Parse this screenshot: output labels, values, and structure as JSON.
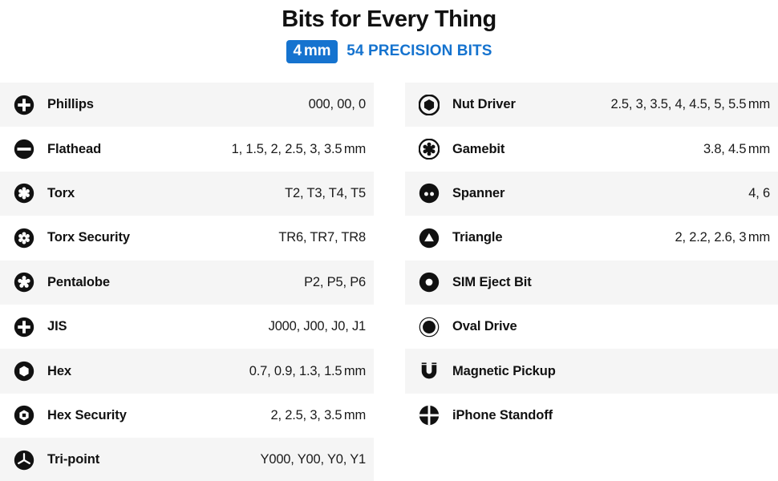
{
  "header": {
    "title": "Bits for Every Thing",
    "badge_value": "4",
    "badge_unit": "mm",
    "count_label": "54 PRECISION BITS",
    "accent_color": "#1573cf"
  },
  "columns": {
    "left": [
      {
        "icon": "phillips-bit-icon",
        "label": "Phillips",
        "value": "000, 00, 0",
        "unit": ""
      },
      {
        "icon": "flathead-bit-icon",
        "label": "Flathead",
        "value": "1, 1.5, 2, 2.5, 3, 3.5",
        "unit": "mm"
      },
      {
        "icon": "torx-bit-icon",
        "label": "Torx",
        "value": "T2, T3, T4, T5",
        "unit": ""
      },
      {
        "icon": "torx-security-bit-icon",
        "label": "Torx Security",
        "value": "TR6, TR7, TR8",
        "unit": ""
      },
      {
        "icon": "pentalobe-bit-icon",
        "label": "Pentalobe",
        "value": "P2, P5, P6",
        "unit": ""
      },
      {
        "icon": "jis-bit-icon",
        "label": "JIS",
        "value": "J000, J00, J0, J1",
        "unit": ""
      },
      {
        "icon": "hex-bit-icon",
        "label": "Hex",
        "value": "0.7, 0.9, 1.3, 1.5",
        "unit": "mm"
      },
      {
        "icon": "hex-security-bit-icon",
        "label": "Hex Security",
        "value": "2, 2.5, 3, 3.5",
        "unit": "mm"
      },
      {
        "icon": "tri-point-bit-icon",
        "label": "Tri-point",
        "value": "Y000, Y00, Y0, Y1",
        "unit": ""
      }
    ],
    "right": [
      {
        "icon": "nut-driver-bit-icon",
        "label": "Nut Driver",
        "value": "2.5, 3, 3.5, 4, 4.5, 5, 5.5",
        "unit": "mm"
      },
      {
        "icon": "gamebit-bit-icon",
        "label": "Gamebit",
        "value": "3.8, 4.5",
        "unit": "mm"
      },
      {
        "icon": "spanner-bit-icon",
        "label": "Spanner",
        "value": "4, 6",
        "unit": ""
      },
      {
        "icon": "triangle-bit-icon",
        "label": "Triangle",
        "value": "2, 2.2, 2.6, 3",
        "unit": "mm"
      },
      {
        "icon": "sim-eject-bit-icon",
        "label": "SIM Eject Bit",
        "value": "",
        "unit": ""
      },
      {
        "icon": "oval-drive-bit-icon",
        "label": "Oval Drive",
        "value": "",
        "unit": ""
      },
      {
        "icon": "magnetic-pickup-icon",
        "label": "Magnetic Pickup",
        "value": "",
        "unit": ""
      },
      {
        "icon": "iphone-standoff-bit-icon",
        "label": "iPhone Standoff",
        "value": "",
        "unit": ""
      }
    ]
  }
}
